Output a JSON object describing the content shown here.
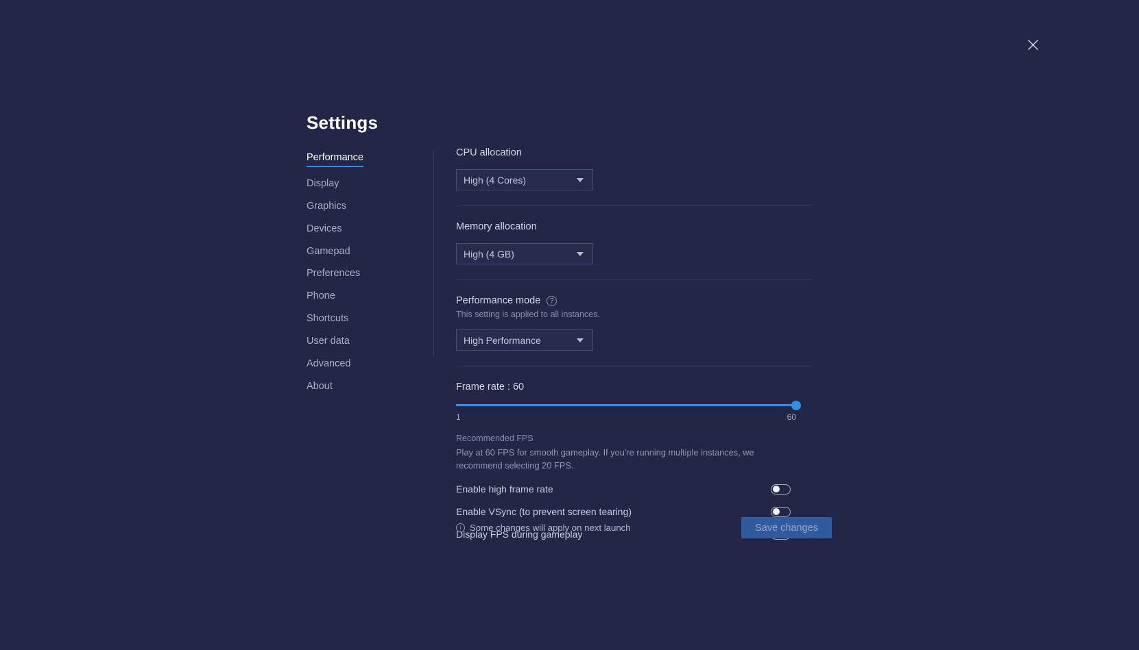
{
  "window": {
    "close_icon": "close-icon"
  },
  "header": {
    "title": "Settings"
  },
  "sidebar": {
    "items": [
      {
        "label": "Performance",
        "active": true
      },
      {
        "label": "Display",
        "active": false
      },
      {
        "label": "Graphics",
        "active": false
      },
      {
        "label": "Devices",
        "active": false
      },
      {
        "label": "Gamepad",
        "active": false
      },
      {
        "label": "Preferences",
        "active": false
      },
      {
        "label": "Phone",
        "active": false
      },
      {
        "label": "Shortcuts",
        "active": false
      },
      {
        "label": "User data",
        "active": false
      },
      {
        "label": "Advanced",
        "active": false
      },
      {
        "label": "About",
        "active": false
      }
    ]
  },
  "main": {
    "cpu": {
      "label": "CPU allocation",
      "value": "High (4 Cores)"
    },
    "memory": {
      "label": "Memory allocation",
      "value": "High (4 GB)"
    },
    "performance_mode": {
      "label": "Performance mode",
      "help_icon": "help-circle-icon",
      "note": "This setting is applied to all instances.",
      "value": "High Performance"
    },
    "frame_rate": {
      "label": "Frame rate : 60",
      "value": 60,
      "min": 1,
      "max": 60,
      "min_label": "1",
      "max_label": "60",
      "fill_percent": 100,
      "accent_color": "#2f90e8"
    },
    "recommendation": {
      "title": "Recommended FPS",
      "body": "Play at 60 FPS for smooth gameplay. If you're running multiple instances, we recommend selecting 20 FPS."
    },
    "toggles": [
      {
        "label": "Enable high frame rate",
        "on": false
      },
      {
        "label": "Enable VSync (to prevent screen tearing)",
        "on": false
      },
      {
        "label": "Display FPS during gameplay",
        "on": false
      }
    ]
  },
  "footer": {
    "notice_icon": "info-circle-icon",
    "notice": "Some changes will apply on next launch",
    "save_label": "Save changes",
    "save_enabled": false
  },
  "theme": {
    "background": "#232745",
    "accent": "#2f90e8",
    "panel": "#272b4c",
    "save_button": "#2f5c9e"
  }
}
